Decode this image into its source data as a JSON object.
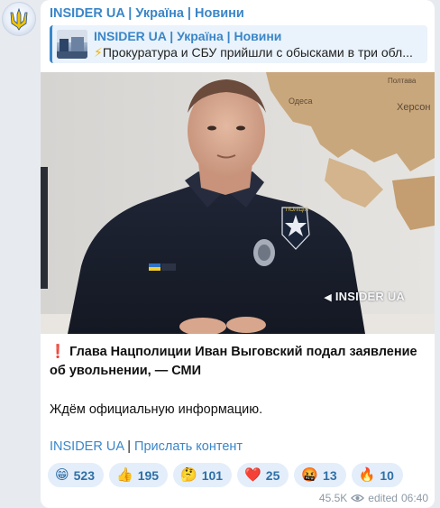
{
  "channel": {
    "name": "INSIDER UA | Україна | Новини",
    "avatar_icon": "trident-icon"
  },
  "reply": {
    "title": "INSIDER UA | Україна | Новини",
    "bolt": "⚡",
    "text": "Прокуратура и СБУ прийшли с обысками в три обл..."
  },
  "photo": {
    "watermark": "INSIDER UA",
    "map_labels": [
      "Одеса",
      "Херсон",
      "Полтава"
    ],
    "chevron_label": "ПОЛІЦІЯ"
  },
  "caption": {
    "excl": "❗",
    "headline": "Глава Нацполиции Иван Выговский подал заявление об увольнении, — СМИ",
    "body": "Ждём официальную информацию."
  },
  "links": {
    "link1": "INSIDER UA",
    "separator": "|",
    "link2": "Прислать контент"
  },
  "reactions": [
    {
      "emoji": "😁",
      "count": "523"
    },
    {
      "emoji": "👍",
      "count": "195"
    },
    {
      "emoji": "🤔",
      "count": "101"
    },
    {
      "emoji": "❤️",
      "count": "25"
    },
    {
      "emoji": "🤬",
      "count": "13"
    },
    {
      "emoji": "🔥",
      "count": "10"
    }
  ],
  "meta": {
    "views": "45.5K",
    "edited": "edited",
    "time": "06:40"
  },
  "colors": {
    "accent": "#3a86c8",
    "bubble": "#ffffff",
    "background": "#e7ebf0",
    "reaction_bg": "#e3eefa"
  }
}
